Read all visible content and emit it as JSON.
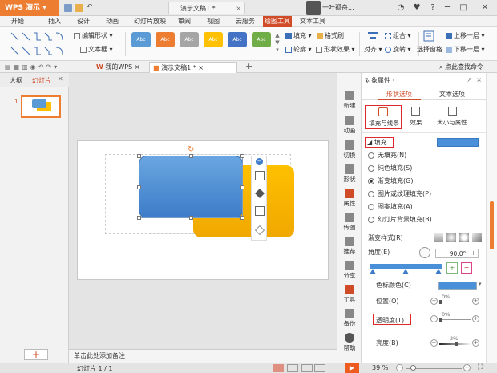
{
  "app": {
    "name": "WPS 演示"
  },
  "tabs": {
    "home_tab": "演示文稿1 *"
  },
  "user": {
    "name": "一叶孤舟..."
  },
  "menu": [
    "开始",
    "插入",
    "设计",
    "动画",
    "幻灯片放映",
    "审阅",
    "视图",
    "云服务",
    "绘图工具",
    "文本工具"
  ],
  "menu_active": "绘图工具",
  "ribbon": {
    "swatches": [
      {
        "label": "Abc",
        "color": "#5b9bd5"
      },
      {
        "label": "Abc",
        "color": "#ed7d31"
      },
      {
        "label": "Abc",
        "color": "#a5a5a5"
      },
      {
        "label": "Abc",
        "color": "#ffc000"
      },
      {
        "label": "Abc",
        "color": "#4472c4"
      },
      {
        "label": "Abc",
        "color": "#70ad47"
      }
    ],
    "edit_shape": "编辑形状",
    "textbox": "文本框",
    "fill": "填充",
    "format_painter": "格式刷",
    "outline": "轮廓",
    "shape_effect": "形状效果",
    "align": "对齐",
    "group": "组合",
    "rotate": "旋转",
    "select_pane": "选择窗格",
    "bring_forward": "上移一层",
    "send_backward": "下移一层"
  },
  "toolbar2": {
    "tab_mywps": "我的WPS",
    "tab_doc": "演示文稿1 *",
    "search": "点此查找命令"
  },
  "leftpanel": {
    "tab_outline": "大纲",
    "tab_slides": "幻灯片",
    "slide_num": "1",
    "add_label": "+"
  },
  "notes_placeholder": "单击此处添加备注",
  "status": {
    "slide_info": "幻灯片 1 / 1",
    "zoom": "39 %"
  },
  "iconcol": [
    "新建",
    "动画",
    "切换",
    "形状",
    "属性",
    "传图",
    "推荐",
    "分享",
    "工具",
    "备份",
    "帮助"
  ],
  "pane": {
    "title": "对象属性 ·",
    "tab_shape": "形状选项",
    "tab_text": "文本选项",
    "sub_fill": "填充与线条",
    "sub_effect": "效果",
    "sub_size": "大小与属性",
    "fill_header": "填充",
    "fill_color": "#4a90d9",
    "options": [
      "无填充(N)",
      "纯色填充(S)",
      "渐变填充(G)",
      "图片或纹理填充(P)",
      "图案填充(A)",
      "幻灯片背景填充(B)"
    ],
    "selected_option": 2,
    "gradient_style": "渐变样式(R)",
    "angle_label": "角度(E)",
    "angle_value": "90.0°",
    "stop_color": "色标颜色(C)",
    "position": "位置(O)",
    "position_value": "0%",
    "transparency": "透明度(T)",
    "transparency_value": "0%",
    "brightness": "亮度(B)",
    "brightness_value": "2%"
  }
}
